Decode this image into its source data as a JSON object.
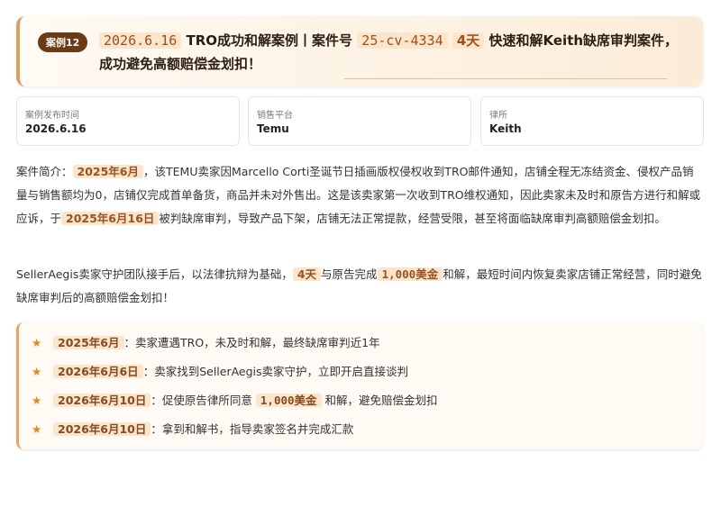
{
  "header": {
    "badge": "案例12",
    "date": "2026.6.16",
    "title_mid": "TRO成功和解案例丨案件号",
    "case_no": "25-cv-4334",
    "days": "4天",
    "title_end": "快速和解Keith缺席审判案件，成功避免高额赔偿金划扣！"
  },
  "info": [
    {
      "label": "案例发布时间",
      "value": "2026.6.16"
    },
    {
      "label": "销售平台",
      "value": "Temu"
    },
    {
      "label": "律所",
      "value": "Keith"
    }
  ],
  "para1": {
    "p1": "案件简介：",
    "d1": "2025年6月",
    "p2": "，该TEMU卖家因Marcello Corti圣诞节日插画版权侵权收到TRO邮件通知，店铺全程无冻结资金、侵权产品销量与销售额均为0，店铺仅完成首单备货，商品并未对外售出。这是该卖家第一次收到TRO维权通知，因此卖家未及时和原告方进行和解或应诉，于",
    "d2": "2025年6月16日",
    "p3": "被判缺席审判，导致产品下架，店铺无法正常提款，经营受限，甚至将面临缺席审判高额赔偿金划扣。"
  },
  "para2": {
    "p1": "SellerAegis卖家守护团队接手后，以法律抗辩为基础，",
    "d1": "4天",
    "p2": "与原告完成",
    "d2": "1,000美金",
    "p3": "和解，最短时间内恢复卖家店铺正常经营，同时避免缺席审判后的高额赔偿金划扣！"
  },
  "timeline": [
    {
      "star": "★",
      "date": "2025年6月",
      "text": "：卖家遭遇TRO，未及时和解，最终缺席审判近1年",
      "amt": "",
      "after": ""
    },
    {
      "star": "★",
      "date": "2026年6月6日",
      "text": "：卖家找到SellerAegis卖家守护，立即开启直接谈判",
      "amt": "",
      "after": ""
    },
    {
      "star": "★",
      "date": "2026年6月10日",
      "text": "：促使原告律所同意",
      "amt": "1,000美金",
      "after": "和解，避免赔偿金划扣"
    },
    {
      "star": "★",
      "date": "2026年6月10日",
      "text": "：拿到和解书，指导卖家签名并完成汇款",
      "amt": "",
      "after": ""
    }
  ]
}
